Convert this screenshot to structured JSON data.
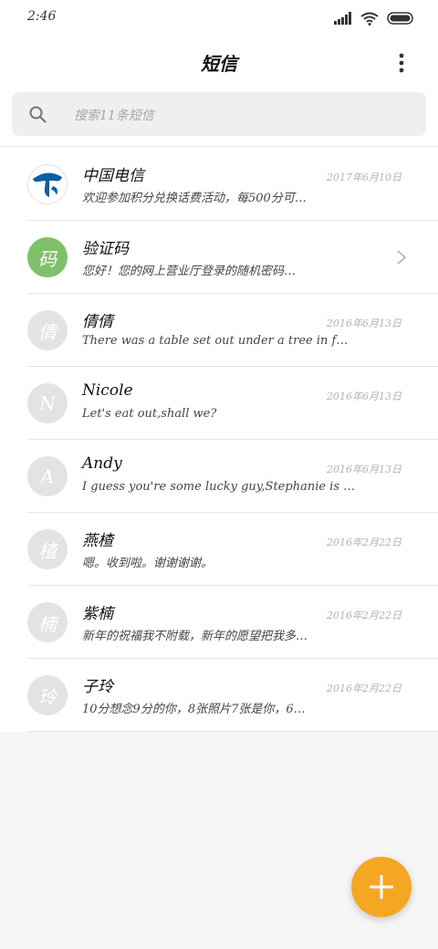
{
  "status_bar": {
    "time": "2:46",
    "icons": [
      "signal-icon",
      "wifi-icon",
      "battery-icon"
    ]
  },
  "header": {
    "title": "短信",
    "more_icon": "more-vertical-icon"
  },
  "search": {
    "placeholder": "搜索11条短信",
    "icon": "search-icon"
  },
  "messages": [
    {
      "sender": "中国电信",
      "avatar_text": "",
      "avatar_icon": "telecom-logo-icon",
      "preview": "欢迎参加积分兑换话费活动，每500分可…",
      "date": "2017年6月10日"
    },
    {
      "sender": "验证码",
      "avatar_text": "码",
      "preview": "您好！您的网上营业厅登录的随机密码…",
      "date": ""
    },
    {
      "sender": "倩倩",
      "avatar_text": "倩",
      "preview": "There was a table set out under a tree in f…",
      "date": "2016年6月13日"
    },
    {
      "sender": "Nicole",
      "avatar_text": "N",
      "preview": "Let's eat out,shall we?",
      "date": "2016年6月13日"
    },
    {
      "sender": "Andy",
      "avatar_text": "A",
      "preview": "I guess you're some lucky guy,Stephanie is …",
      "date": "2016年6月13日"
    },
    {
      "sender": "燕楂",
      "avatar_text": "楂",
      "preview": "嗯。收到啦。谢谢谢谢。",
      "date": "2016年2月22日"
    },
    {
      "sender": "紫楠",
      "avatar_text": "楠",
      "preview": "新年的祝福我不附载，新年的愿望把我多…",
      "date": "2016年2月22日"
    },
    {
      "sender": "子玲",
      "avatar_text": "玲",
      "preview": "10分想念9分的你，8张照片7张是你，6…",
      "date": "2016年2月22日"
    }
  ],
  "fab": {
    "icon": "plus-icon"
  },
  "colors": {
    "accent": "#f5a623",
    "avatar_green": "#7fc06a",
    "avatar_gray": "#e3e3e3",
    "telecom_blue": "#0b5fa5"
  }
}
